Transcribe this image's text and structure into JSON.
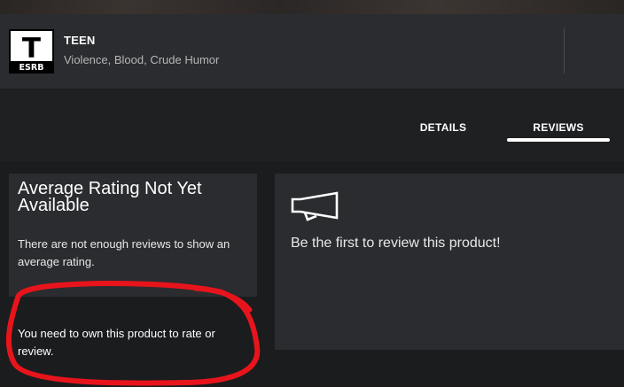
{
  "rating": {
    "badge_letter": "T",
    "badge_org": "ESRB",
    "name": "TEEN",
    "descriptors": "Violence, Blood, Crude Humor"
  },
  "tabs": [
    {
      "label": "DETAILS",
      "active": false
    },
    {
      "label": "REVIEWS",
      "active": true
    }
  ],
  "average_rating": {
    "title": "Average Rating Not Yet Available",
    "message": "There are not enough reviews to show an average rating."
  },
  "ownership_notice": "You need to own this product to rate or review.",
  "review_prompt": {
    "icon": "megaphone-icon",
    "text": "Be the first to review this product!"
  },
  "colors": {
    "background": "#1f2022",
    "card": "#2b2c2f",
    "text": "#ffffff",
    "muted_text": "#b6b6b8",
    "annotation": "#e8141c"
  }
}
